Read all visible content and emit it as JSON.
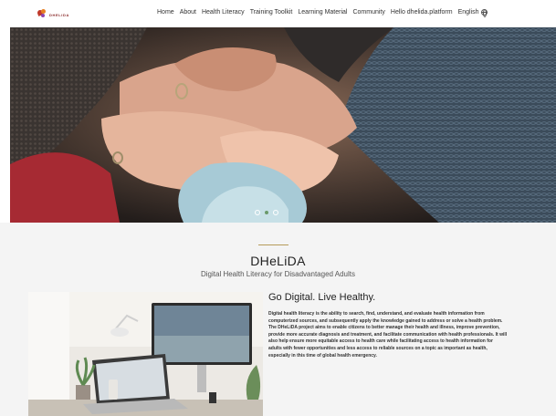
{
  "logo": {
    "text": "DHELIDA"
  },
  "nav": {
    "items": [
      "Home",
      "About",
      "Health Literacy",
      "Training Toolkit",
      "Learning Material",
      "Community",
      "Hello dhelida.platform"
    ],
    "language": "English"
  },
  "hero": {
    "slides": 3,
    "active_slide": 2
  },
  "section": {
    "title": "DHeLiDA",
    "subtitle": "Digital Health Literacy for Disadvantaged Adults",
    "tagline": "Go Digital. Live Healthy.",
    "description": "Digital health literacy is the ability to search, find, understand, and evaluate health information from computerized sources, and subsequently apply the knowledge gained to address or solve a health problem. The DHeLiDA project aims to enable citizens to better manage their health and illness, improve prevention, provide more accurate diagnosis and treatment, and facilitate communication with health professionals. It will also help ensure more equitable access to health care while facilitating access to health information for adults with fewer opportunities and less access to reliable sources on a topic as important as health, especially in this time of global health emergency."
  },
  "colors": {
    "accent": "#b59b5a",
    "active_dot": "#6b9a6b",
    "band": "#f4f4f4"
  }
}
